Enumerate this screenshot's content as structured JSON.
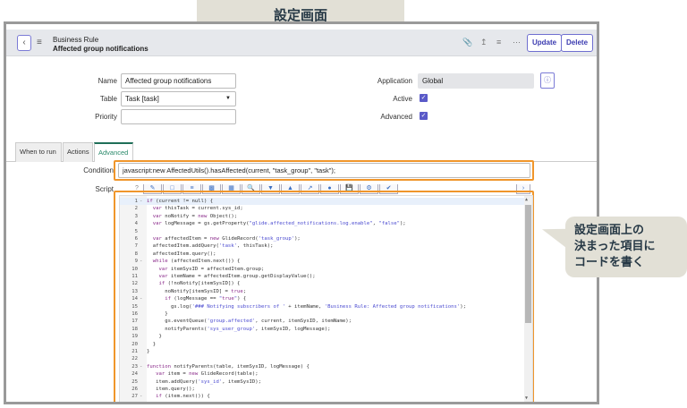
{
  "banner": "設定画面",
  "callout": [
    "設定画面上の",
    "決まった項目に",
    "コードを書く"
  ],
  "header": {
    "record_type": "Business Rule",
    "record_name": "Affected group notifications",
    "update_label": "Update",
    "delete_label": "Delete",
    "icons": [
      "paperclip-icon",
      "activity-icon",
      "sliders-icon",
      "more-icon"
    ]
  },
  "form": {
    "name_label": "Name",
    "name_value": "Affected group notifications",
    "table_label": "Table",
    "table_value": "Task [task]",
    "priority_label": "Priority",
    "priority_value": "",
    "application_label": "Application",
    "application_value": "Global",
    "active_label": "Active",
    "active": true,
    "advanced_label": "Advanced",
    "advanced": true
  },
  "tabs": [
    {
      "label": "When to run"
    },
    {
      "label": "Actions"
    },
    {
      "label": "Advanced",
      "active": true
    }
  ],
  "condition": {
    "label": "Condition",
    "value": "javascript:new AffectedUtils().hasAffected(current, \"task_group\", \"task\");"
  },
  "script": {
    "label": "Script",
    "lines": [
      "if (current != null) {",
      "  var thisTask = current.sys_id;",
      "  var noNotify = new Object();",
      "  var logMessage = gs.getProperty(\"glide.affected_notifications.log.enable\", \"false\");",
      "",
      "  var affectedItem = new GlideRecord('task_group');",
      "  affectedItem.addQuery('task', thisTask);",
      "  affectedItem.query();",
      "  while (affectedItem.next()) {",
      "    var itemSysID = affectedItem.group;",
      "    var itemName = affectedItem.group.getDisplayValue();",
      "    if (!noNotify[itemSysID]) {",
      "      noNotify[itemSysID] = true;",
      "      if (logMessage == \"true\") {",
      "        gs.log('### Notifying subscribers of ' + itemName, 'Business Rule: Affected group notifications');",
      "      }",
      "      gs.eventQueue('group.affected', current, itemSysID, itemName);",
      "      notifyParents('sys_user_group', itemSysID, logMessage);",
      "    }",
      "  }",
      "}",
      "",
      "function notifyParents(table, itemSysID, logMessage) {",
      "   var item = new GlideRecord(table);",
      "   item.addQuery('sys_id', itemSysID);",
      "   item.query();",
      "   if (item.next()) {"
    ]
  },
  "colors": {
    "highlight": "#f0962b",
    "accent": "#5a5ac8"
  }
}
